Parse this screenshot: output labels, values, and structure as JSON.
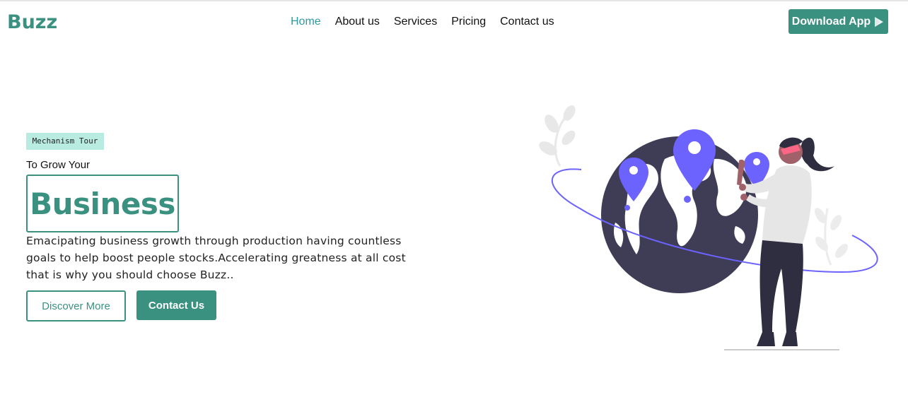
{
  "brand": {
    "logo_text": "Buzz",
    "accent_color": "#3a9180"
  },
  "nav": {
    "items": [
      {
        "label": "Home",
        "active": true
      },
      {
        "label": "About us",
        "active": false
      },
      {
        "label": "Services",
        "active": false
      },
      {
        "label": "Pricing",
        "active": false
      },
      {
        "label": "Contact us",
        "active": false
      }
    ],
    "active_color": "#2e9aa3"
  },
  "header": {
    "download_button_label": "Download App",
    "download_icon": "play-store-icon"
  },
  "hero": {
    "tag": "Mechanism Tour",
    "pre_title": "To Grow Your",
    "title": "Business",
    "description": "Emacipating business growth through production having countless goals to help boost people stocks.Accelerating greatness at all cost that is why you should choose Buzz..",
    "primary_button": "Contact Us",
    "secondary_button": "Discover More"
  },
  "illustration": {
    "name": "woman-with-globe-and-map-pins",
    "pin_color": "#6c63ff",
    "globe_color": "#3f3d56"
  }
}
